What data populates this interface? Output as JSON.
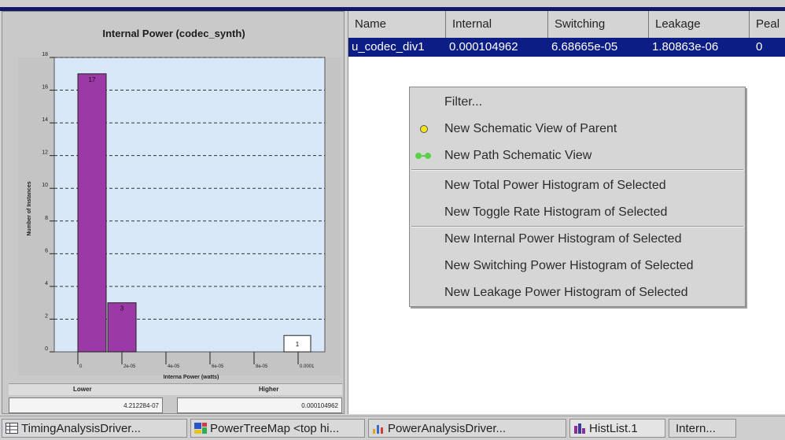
{
  "window": {
    "title": ""
  },
  "histogram": {
    "chart_data": {
      "type": "bar",
      "title": "Internal Power (codec_synth)",
      "xlabel": "Interna Power (watts)",
      "ylabel": "Number of Instances",
      "yticks": [
        "0",
        "2",
        "4",
        "6",
        "8",
        "10",
        "12",
        "14",
        "16",
        "18"
      ],
      "ylim": [
        0,
        18
      ],
      "xticks": [
        "0",
        "2e-05",
        "4e-05",
        "6e-05",
        "8e-05",
        "0.0001"
      ],
      "categories": [
        "0–2e-05",
        "2e-05–4e-05",
        "4e-05–6e-05",
        "6e-05–8e-05",
        "8e-05–0.0001",
        "0.0001+"
      ],
      "values": [
        17,
        3,
        0,
        0,
        0,
        1
      ],
      "value_labels": [
        "17",
        "3",
        "",
        "",
        "",
        "1"
      ],
      "grid": true,
      "series_colors": [
        "#9b39a6",
        "#ffffff"
      ]
    },
    "lower_label": "Lower",
    "higher_label": "Higher",
    "lower_value": "4.212284-07",
    "higher_value": "0.000104962"
  },
  "table": {
    "columns": [
      "Name",
      "Internal",
      "Switching",
      "Leakage",
      "Peal"
    ],
    "selected_row": [
      "u_codec_div1",
      "0.000104962",
      "6.68665e-05",
      "1.80863e-06",
      "0"
    ]
  },
  "context_menu": {
    "items": [
      {
        "label": "Filter..."
      },
      {
        "label": "New Schematic View of Parent",
        "icon": "yellow-dot-icon"
      },
      {
        "label": "New Path Schematic View",
        "icon": "green-path-icon"
      },
      {
        "label": "New Total Power Histogram of Selected"
      },
      {
        "label": "New Toggle Rate Histogram of Selected"
      },
      {
        "label": "New Internal Power Histogram of Selected"
      },
      {
        "label": "New Switching Power Histogram of Selected"
      },
      {
        "label": "New Leakage Power Histogram of Selected"
      }
    ]
  },
  "taskbar": {
    "items": [
      {
        "label": "TimingAnalysisDriver...",
        "icon": "table-icon"
      },
      {
        "label": "PowerTreeMap <top hi...",
        "icon": "treemap-icon"
      },
      {
        "label": "PowerAnalysisDriver...",
        "icon": "chart-icon"
      },
      {
        "label": "HistList.1",
        "icon": "histogram-icon"
      },
      {
        "label": "Intern..."
      }
    ]
  },
  "colors": {
    "selection": "#0c1d86",
    "bar": "#9b39a6",
    "plot_bg": "#d8e8f8",
    "title_bar": "#14186a"
  }
}
